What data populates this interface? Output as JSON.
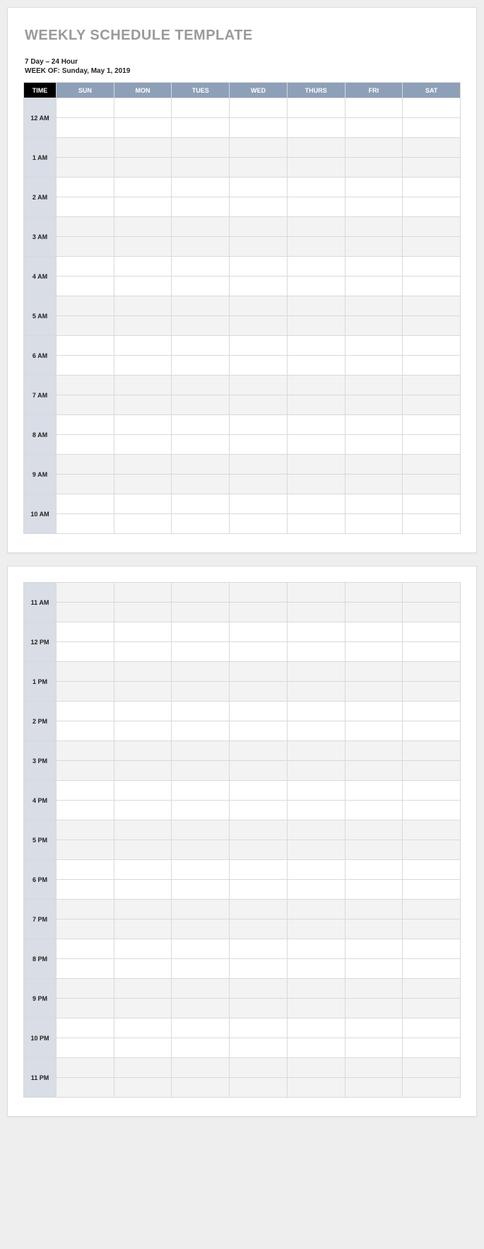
{
  "title": "WEEKLY SCHEDULE TEMPLATE",
  "subtitle": "7 Day – 24 Hour",
  "week_of_label": "WEEK OF:",
  "week_of_value": "Sunday, May 1, 2019",
  "header": {
    "time": "TIME",
    "days": [
      "SUN",
      "MON",
      "TUES",
      "WED",
      "THURS",
      "FRI",
      "SAT"
    ]
  },
  "hours_page1": [
    "12 AM",
    "1 AM",
    "2 AM",
    "3 AM",
    "4 AM",
    "5 AM",
    "6 AM",
    "7 AM",
    "8 AM",
    "9 AM",
    "10 AM"
  ],
  "hours_page2": [
    "11 AM",
    "12 PM",
    "1 PM",
    "2 PM",
    "3 PM",
    "4 PM",
    "5 PM",
    "6 PM",
    "7 PM",
    "8 PM",
    "9 PM",
    "10 PM",
    "11 PM"
  ]
}
